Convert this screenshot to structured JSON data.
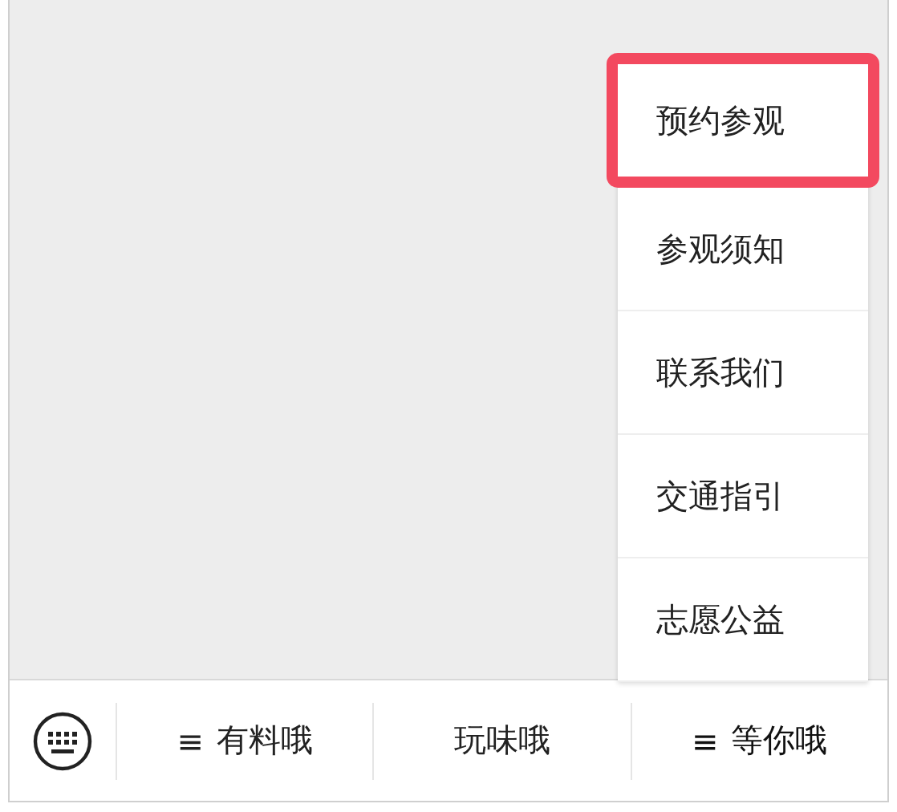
{
  "menu_bar": {
    "items": [
      {
        "icon": "≡",
        "label": "有料哦",
        "expanded": false
      },
      {
        "label": "玩味哦",
        "expanded": false
      },
      {
        "icon": "≡",
        "label": "等你哦",
        "expanded": true
      }
    ]
  },
  "submenu": {
    "items": [
      {
        "label": "预约参观",
        "selected": true
      },
      {
        "label": "参观须知",
        "selected": false
      },
      {
        "label": "联系我们",
        "selected": false
      },
      {
        "label": "交通指引",
        "selected": false
      },
      {
        "label": "志愿公益",
        "selected": false
      }
    ]
  }
}
